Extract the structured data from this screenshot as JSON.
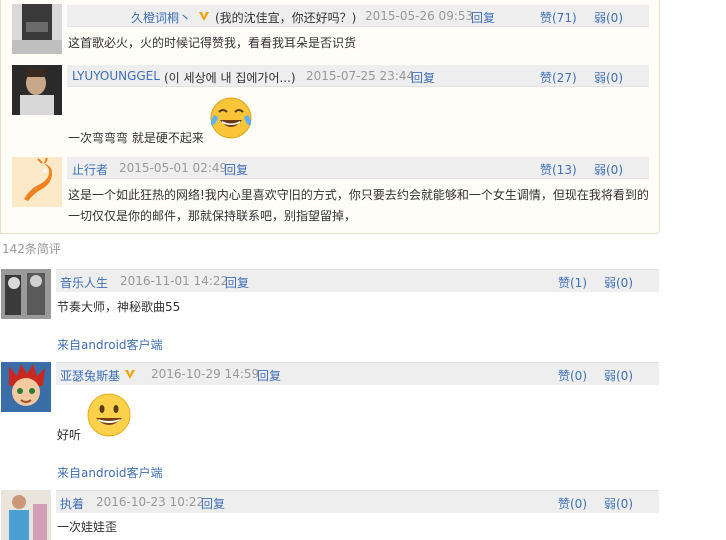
{
  "hot_comments": [
    {
      "nickname": "久橙词桐丶",
      "extra": "(我的沈佳宜，你还好吗？)",
      "time": "2015-05-26 09:53",
      "reply": "回复",
      "like": "赞(71)",
      "dislike": "弱(0)",
      "text": "这首歌必火，火的时候记得赞我，看看我耳朵是否识货"
    },
    {
      "nickname": "LYUYOUNGGEL",
      "extra": "(이 세상에 내 집에가어...)",
      "time": "2015-07-25 23:44",
      "reply": "回复",
      "like": "赞(27)",
      "dislike": "弱(0)",
      "text": "一次弯弯弯 就是硬不起来",
      "emoji": "tears-of-joy-emoji"
    },
    {
      "nickname": "止行者",
      "time": "2015-05-01 02:49",
      "reply": "回复",
      "like": "赞(13)",
      "dislike": "弱(0)",
      "text": "这是一个如此狂热的网络!我内心里喜欢守旧的方式，你只要去约会就能够和一个女生调情，但现在我将看到的一切仅仅是你的邮件，那就保持联系吧，别指望留掉，"
    }
  ],
  "count_label": "142条简评",
  "comments": [
    {
      "nickname": "音乐人生",
      "time": "2016-11-01 14:22",
      "reply": "回复",
      "like": "赞(1)",
      "dislike": "弱(0)",
      "text": "节奏大师，神秘歌曲55",
      "source": "来自android客户端"
    },
    {
      "nickname": "亚瑟兔斯基",
      "time": "2016-10-29 14:59",
      "reply": "回复",
      "like": "赞(0)",
      "dislike": "弱(0)",
      "text": "好听",
      "emoji": "grinning-emoji",
      "source": "来自android客户端"
    },
    {
      "nickname": "执着",
      "time": "2016-10-23 10:22",
      "reply": "回复",
      "like": "赞(0)",
      "dislike": "弱(0)",
      "text": "一次娃娃歪"
    }
  ],
  "colors": {
    "link": "#3f6fb5",
    "meta": "#999999",
    "header_bg": "#eeeeee",
    "hot_border": "#f2dfc4",
    "vip_badge": "#f0a400"
  }
}
